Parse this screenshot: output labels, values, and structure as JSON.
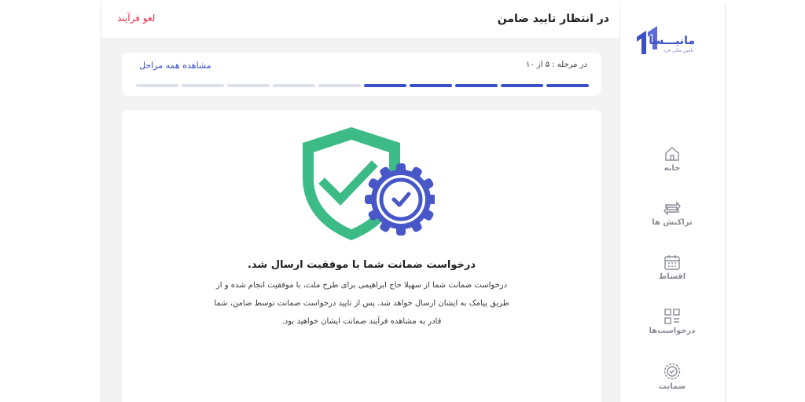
{
  "brand": {
    "name": "مانیـــسا",
    "tagline": "تامین مالی خرد"
  },
  "header": {
    "title": "در انتظار تایید ضامن",
    "cancel_label": "لغو فرآیند"
  },
  "steps": {
    "status_text": "در مرحله : ۵ از ۱۰",
    "view_all_label": "مشاهده همه مراحل",
    "current": 5,
    "total": 10
  },
  "result": {
    "title": "درخواست ضمانت شما با موفقیت ارسال شد.",
    "description": "درخواست ضمانت شما از سهیلا حاج ابراهیمی برای طرح ملت، با موفقیت انجام شده و از طریق پیامک به ایشان ارسال خواهد شد. پس از تایید درخواست ضمانت توسط ضامن، شما قادر به مشاهده فرآیند ضمانت ایشان خواهید بود."
  },
  "nav": [
    {
      "label": "خانه",
      "icon": "home-icon"
    },
    {
      "label": "تراکنش ها",
      "icon": "transfer-icon"
    },
    {
      "label": "اقساط",
      "icon": "calendar-icon"
    },
    {
      "label": "درخواست‌ها",
      "icon": "grid-icon"
    },
    {
      "label": "ضمانت",
      "icon": "badge-icon"
    }
  ],
  "colors": {
    "primary": "#3b4fc6",
    "progress_done": "#3b4fc6",
    "progress_todo": "#dde1ef",
    "shield_green": "#3dbb87",
    "danger": "#e1304b"
  }
}
